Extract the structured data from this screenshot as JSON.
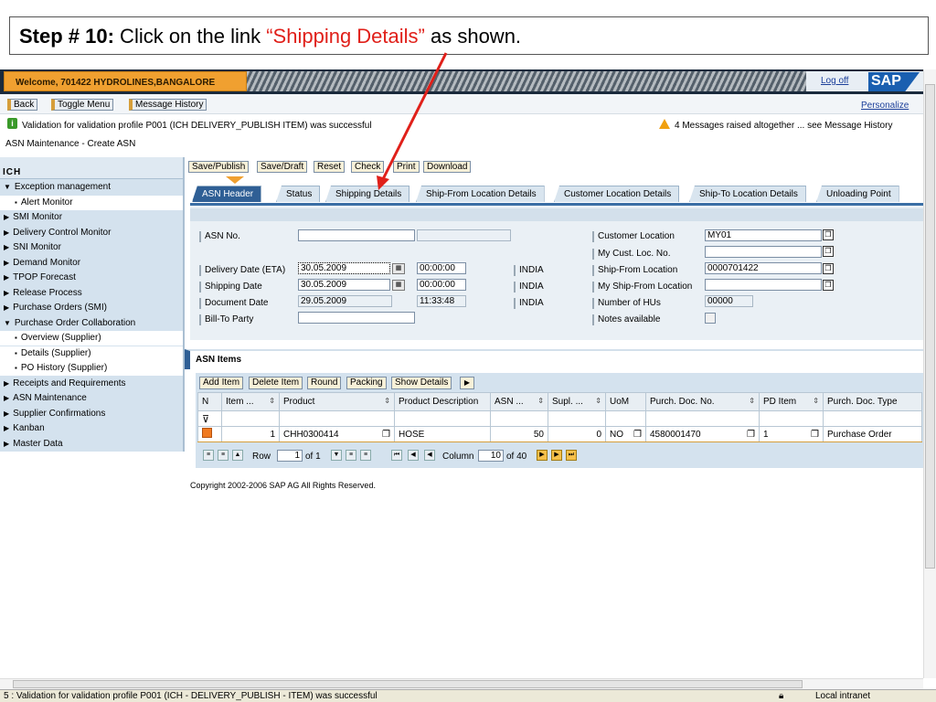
{
  "callout": {
    "step_label": "Step # 10:",
    "text_before": " Click on the link ",
    "highlight": "“Shipping Details”",
    "text_after": " as shown."
  },
  "header": {
    "welcome": "Welcome, 701422   HYDROLINES,BANGALORE",
    "logoff": "Log off",
    "logo": "SAP"
  },
  "toolbar": {
    "back": "Back",
    "toggle_menu": "Toggle Menu",
    "message_history": "Message History",
    "personalize": "Personalize"
  },
  "messages": {
    "ok_text": "Validation for validation profile P001 (ICH   DELIVERY_PUBLISH   ITEM) was successful",
    "warn_text": "4 Messages raised altogether ... see Message History"
  },
  "page_title": "ASN Maintenance - Create ASN",
  "nav": {
    "header": "ICH",
    "items": [
      {
        "label": "Exception management",
        "level": 0,
        "expand": "▼"
      },
      {
        "label": "Alert Monitor",
        "level": 1,
        "expand": "▪"
      },
      {
        "label": "SMI Monitor",
        "level": 0,
        "expand": "▶"
      },
      {
        "label": "Delivery Control Monitor",
        "level": 0,
        "expand": "▶"
      },
      {
        "label": "SNI Monitor",
        "level": 0,
        "expand": "▶"
      },
      {
        "label": "Demand Monitor",
        "level": 0,
        "expand": "▶"
      },
      {
        "label": "TPOP Forecast",
        "level": 0,
        "expand": "▶"
      },
      {
        "label": "Release Process",
        "level": 0,
        "expand": "▶"
      },
      {
        "label": "Purchase Orders (SMI)",
        "level": 0,
        "expand": "▶"
      },
      {
        "label": "Purchase Order Collaboration",
        "level": 0,
        "expand": "▼"
      },
      {
        "label": "Overview (Supplier)",
        "level": 1,
        "expand": "▪"
      },
      {
        "label": "Details (Supplier)",
        "level": 1,
        "expand": "▪"
      },
      {
        "label": "PO History (Supplier)",
        "level": 1,
        "expand": "▪"
      },
      {
        "label": "Receipts and Requirements",
        "level": 0,
        "expand": "▶"
      },
      {
        "label": "ASN Maintenance",
        "level": 0,
        "expand": "▶"
      },
      {
        "label": "Supplier Confirmations",
        "level": 0,
        "expand": "▶"
      },
      {
        "label": "Kanban",
        "level": 0,
        "expand": "▶"
      },
      {
        "label": "Master Data",
        "level": 0,
        "expand": "▶"
      }
    ]
  },
  "actions": {
    "save_publish": "Save/Publish",
    "save_draft": "Save/Draft",
    "reset": "Reset",
    "check": "Check",
    "print": "Print",
    "download": "Download"
  },
  "tabs": [
    "ASN Header",
    "Status",
    "Shipping Details",
    "Ship-From Location Details",
    "Customer Location Details",
    "Ship-To Location Details",
    "Unloading Point"
  ],
  "form": {
    "asn_no_label": "ASN No.",
    "asn_no": "",
    "asn_no2": "",
    "delivery_date_label": "Delivery Date (ETA)",
    "delivery_date": "30.05.2009",
    "delivery_time": "00:00:00",
    "delivery_tz": "INDIA",
    "shipping_date_label": "Shipping Date",
    "shipping_date": "30.05.2009",
    "shipping_time": "00:00:00",
    "shipping_tz": "INDIA",
    "document_date_label": "Document Date",
    "document_date": "29.05.2009",
    "document_time": "11:33:48",
    "document_tz": "INDIA",
    "bill_to_label": "Bill-To Party",
    "bill_to": "",
    "customer_location_label": "Customer Location",
    "customer_location": "MY01",
    "my_cust_loc_label": "My Cust. Loc. No.",
    "my_cust_loc": "",
    "ship_from_label": "Ship-From Location",
    "ship_from": "0000701422",
    "my_ship_from_label": "My Ship-From Location",
    "my_ship_from": "",
    "hus_label": "Number of HUs",
    "hus": "00000",
    "notes_label": "Notes available"
  },
  "items": {
    "title": "ASN Items",
    "buttons": [
      "Add Item",
      "Delete Item",
      "Round",
      "Packing",
      "Show Details"
    ],
    "columns": [
      "N",
      "Item ...",
      "Product",
      "Product Description",
      "ASN ...",
      "Supl. ...",
      "UoM",
      "Purch. Doc. No.",
      "PD Item",
      "Purch. Doc. Type"
    ],
    "row": {
      "item": "1",
      "product": "CHH0300414",
      "description": "HOSE",
      "asn_qty": "50",
      "supl_qty": "0",
      "uom": "NO",
      "purch_doc": "4580001470",
      "pd_item": "1",
      "doc_type": "Purchase Order"
    },
    "pager": {
      "row_label": "Row",
      "row_value": "1",
      "of_rows": "of 1",
      "column_label": "Column",
      "column_value": "10",
      "of_columns": "of 40"
    }
  },
  "copyright": "Copyright 2002-2006 SAP AG All Rights Reserved.",
  "statusbar": {
    "text": "5 : Validation for validation profile P001 (ICH - DELIVERY_PUBLISH - ITEM) was successful",
    "zone": "Local intranet"
  }
}
